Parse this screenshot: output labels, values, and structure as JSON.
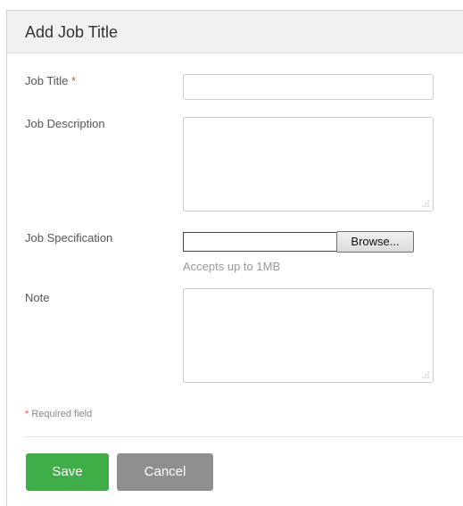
{
  "header": {
    "title": "Add Job Title"
  },
  "form": {
    "job_title": {
      "label": "Job Title",
      "required_marker": "*",
      "value": ""
    },
    "job_description": {
      "label": "Job Description",
      "value": ""
    },
    "job_specification": {
      "label": "Job Specification",
      "browse_label": "Browse...",
      "hint": "Accepts up to 1MB"
    },
    "note": {
      "label": "Note",
      "value": ""
    },
    "required_note": {
      "marker": "*",
      "text": "Required field"
    }
  },
  "actions": {
    "save_label": "Save",
    "cancel_label": "Cancel"
  },
  "colors": {
    "save": "#3fae49",
    "cancel": "#8f8f8f",
    "required": "#d9534f"
  },
  "icons": {
    "resize_grip": "resize-grip-icon"
  }
}
